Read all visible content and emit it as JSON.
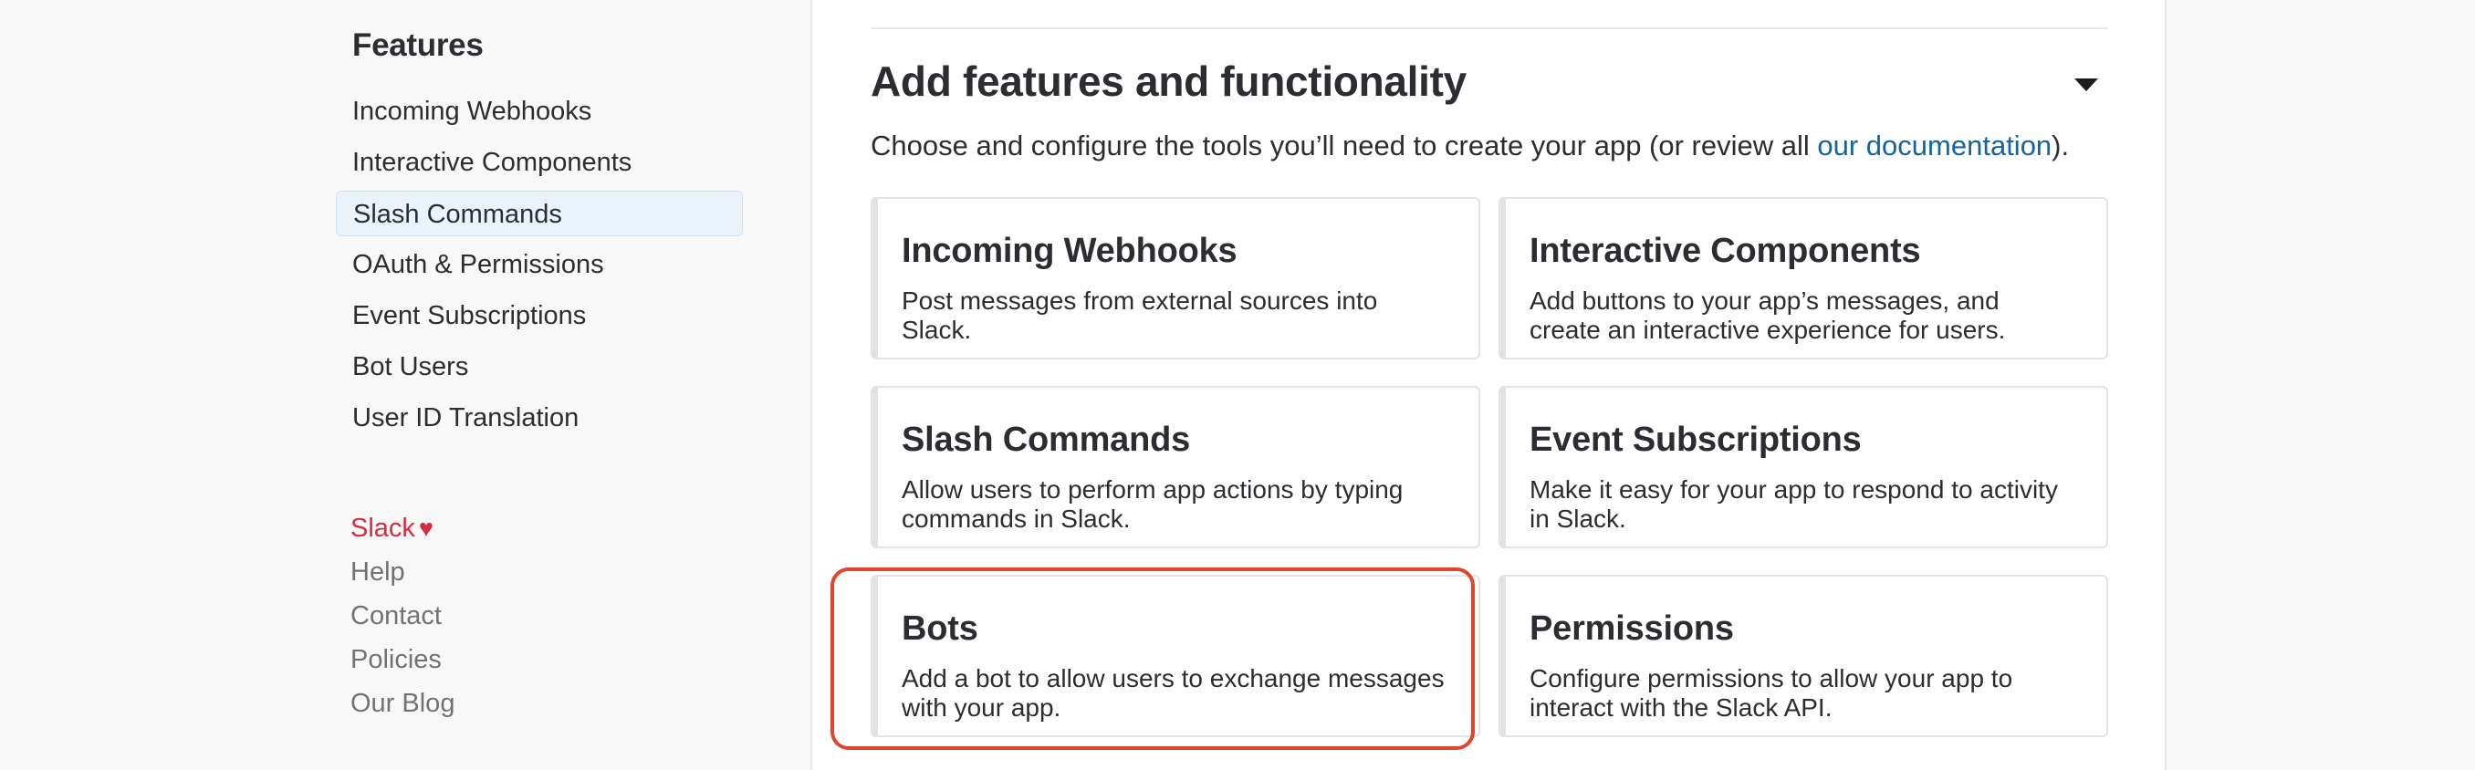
{
  "sidebar": {
    "heading": "Features",
    "items": [
      {
        "label": "Incoming Webhooks"
      },
      {
        "label": "Interactive Components"
      },
      {
        "label": "Slash Commands",
        "active": true
      },
      {
        "label": "OAuth & Permissions"
      },
      {
        "label": "Event Subscriptions"
      },
      {
        "label": "Bot Users"
      },
      {
        "label": "User ID Translation"
      }
    ],
    "footer": {
      "brand": "Slack",
      "brand_icon": "heart-icon",
      "links": [
        "Help",
        "Contact",
        "Policies",
        "Our Blog"
      ]
    }
  },
  "main": {
    "title": "Add features and functionality",
    "collapse_icon": "caret-down-icon",
    "description_prefix": "Choose and configure the tools you’ll need to create your app (or review all ",
    "description_link": "our documentation",
    "description_suffix": ").",
    "cards": [
      {
        "title": "Incoming Webhooks",
        "description": "Post messages from external sources into Slack."
      },
      {
        "title": "Interactive Components",
        "description": "Add buttons to your app’s messages, and create an interactive experience for users."
      },
      {
        "title": "Slash Commands",
        "description": "Allow users to perform app actions by typing commands in Slack."
      },
      {
        "title": "Event Subscriptions",
        "description": "Make it easy for your app to respond to activity in Slack."
      },
      {
        "title": "Bots",
        "description": "Add a bot to allow users to exchange messages with your app.",
        "highlighted": true
      },
      {
        "title": "Permissions",
        "description": "Configure permissions to allow your app to interact with the Slack API."
      }
    ]
  },
  "colors": {
    "link": "#1264a3",
    "brand": "#d72b3f",
    "highlight": "#e0452e",
    "active_nav_bg": "#eaf2fb"
  }
}
